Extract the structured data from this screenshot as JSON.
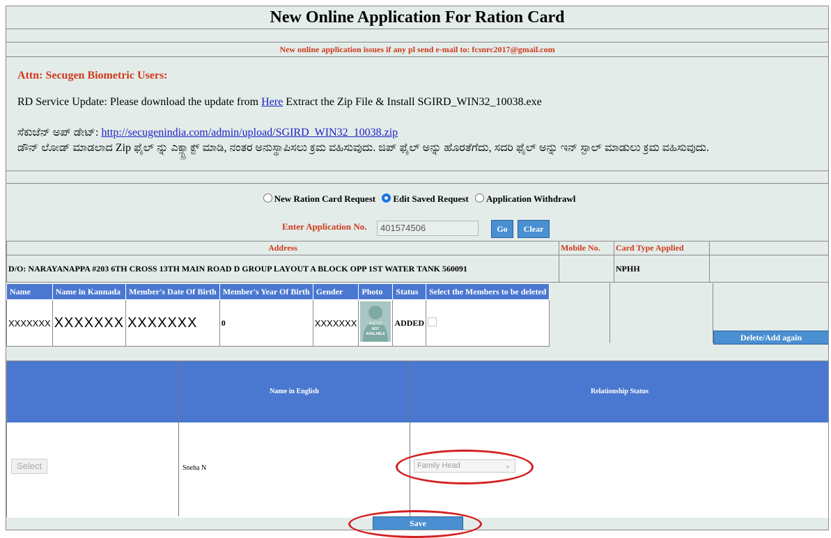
{
  "page": {
    "title": "New Online Application For Ration Card"
  },
  "email_notice": "New online application issues if any pl send e-mail to: fcsnrc2017@gmail.com",
  "notice": {
    "attn": "Attn: Secugen Biometric Users:",
    "update_prefix": "RD Service Update: Please download the update from",
    "here_link": "Here",
    "update_suffix": "Extract the Zip File & Install SGIRD_WIN32_10038.exe",
    "kannada_label": "ಸೆಕುಜೆನ್ ಅಪ್ ಡೇಟ್:",
    "kannada_link": "http://secugenindia.com/admin/upload/SGIRD_WIN32_10038.zip",
    "kannada_instructions": "ಡೌನ್ ಲೋಡ್ ಮಾಡಲಾದ Zip ಫೈಲ್ ನ್ನು ಎಕ್ಸ್ಟ್ರಾಕ್ಟ್ ಮಾಡಿ, ನಂತರ ಅನುಸ್ಥಾಪಿಸಲು ಕ್ರಮ ವಹಿಸುವುದು. ಜಿಪ್ ಫೈಲ್ ಅನ್ನು ಹೊರತೆಗೆದು, ಸದರಿ ಫೈಲ್ ಅನ್ನು ಇನ್ ಸ್ಟಾಲ್ ಮಾಡುಲು ಕ್ರಮ ವಹಿಸುವುದು."
  },
  "request_type": {
    "options": [
      "New Ration Card Request",
      "Edit Saved Request",
      "Application Withdrawl"
    ],
    "selected": "Edit Saved Request"
  },
  "application": {
    "label": "Enter Application No.",
    "value": "401574506",
    "go_label": "Go",
    "clear_label": "Clear"
  },
  "address_table": {
    "address_header": "Address",
    "mobile_header": "Mobile No.",
    "card_type_header": "Card Type Applied",
    "address_value": "D/O: NARAYANAPPA #203 6TH CROSS 13TH MAIN ROAD D GROUP LAYOUT A BLOCK OPP 1ST WATER TANK 560091",
    "mobile_value": "",
    "card_type_value": "NPHH"
  },
  "members": {
    "headers": [
      "Name",
      "Name in Kannada",
      "Member's Date Of Birth",
      "Member's Year Of Birth",
      "Gender",
      "Photo",
      "Status",
      "Select the Members to be deleted"
    ],
    "row": {
      "name": "XXXXXXX",
      "name_kannada": "XXXXXXX",
      "dob": "XXXXXXX",
      "yob": "0",
      "gender": "XXXXXXX",
      "photo_text": "PHOTO NOT AVAILABLE",
      "status": "ADDED"
    },
    "delete_label": "Delete/Add again"
  },
  "relationship": {
    "name_header": "Name in English",
    "status_header": "Relationship Status",
    "select_label": "Select",
    "name_value": "Sneha N",
    "status_value": "Family Head"
  },
  "save_label": "Save",
  "colors": {
    "header_blue": "#4a78d0",
    "button_blue": "#4a8fd1",
    "accent_red": "#d0391c",
    "highlight_red": "#d42020"
  }
}
